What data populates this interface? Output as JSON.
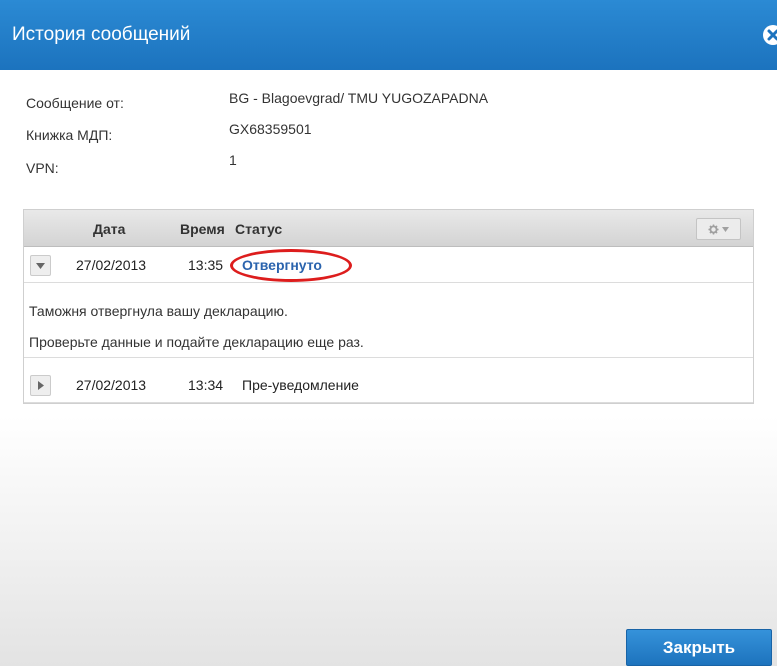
{
  "dialog": {
    "title": "История сообщений",
    "close_icon": "close-circle-icon",
    "close_button_label": "Закрыть"
  },
  "info": {
    "from_label": "Сообщение от:",
    "from_value": "BG - Blagoevgrad/ TMU YUGOZAPADNA",
    "book_label": "Книжка МДП:",
    "book_value": "GX68359501",
    "vpn_label": "VPN:",
    "vpn_value": "1"
  },
  "table": {
    "columns": [
      "Дата",
      "Время",
      "Статус"
    ],
    "settings_icon": "gear-icon",
    "rows": [
      {
        "date": "27/02/2013",
        "time": "13:35",
        "status": "Отвергнуто",
        "expanded": true,
        "details": [
          "Таможня отвергнула вашу декларацию.",
          "Проверьте данные и подайте декларацию еще раз."
        ]
      },
      {
        "date": "27/02/2013",
        "time": "13:34",
        "status": "Пре-уведомление",
        "expanded": false
      }
    ]
  },
  "colors": {
    "titlebar": "#1c73be",
    "status_link": "#2a63ad",
    "highlight": "#dd1d1d",
    "primary_button": "#1d73bd"
  }
}
